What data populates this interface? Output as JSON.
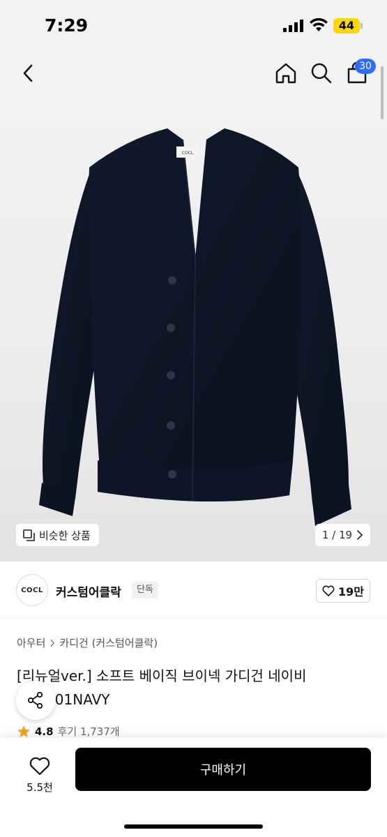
{
  "status_bar": {
    "time": "7:29",
    "battery": "44",
    "icons": [
      "signal-icon",
      "wifi-icon",
      "battery-icon"
    ]
  },
  "nav": {
    "icons": [
      "back-icon",
      "home-icon",
      "search-icon",
      "cart-icon"
    ],
    "cart_count": "30"
  },
  "gallery": {
    "similar_label": "비슷한 상품",
    "pager": "1 / 19",
    "brand_tag": "COCL"
  },
  "brand": {
    "logo_text": "COCL",
    "name": "커스텀어클락",
    "badge": "단독",
    "like_count": "19만"
  },
  "breadcrumb": {
    "category": "아우터",
    "subcategory": "카디건 (커스텀어클락)"
  },
  "product": {
    "title": "[리뉴얼ver.] 소프트 베이직 브이넥 가디건 네이비 SCD001NAVY",
    "rating": "4.8",
    "reviews": "후기 1,737개"
  },
  "bottom": {
    "wish_count": "5.5천",
    "buy_label": "구매하기"
  },
  "colors": {
    "accent_blue": "#2f6bff",
    "battery_yellow": "#ffd60a",
    "cardigan_navy": "#0d1526",
    "buy_black": "#000000",
    "star": "#f4a51c"
  }
}
